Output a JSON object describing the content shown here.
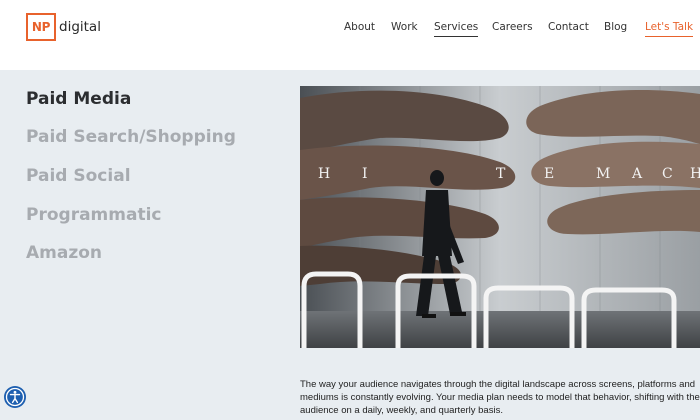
{
  "brand": {
    "logo_mark": "NP",
    "logo_text": "digital",
    "accent": "#e8622c"
  },
  "nav": {
    "items": [
      {
        "label": "About"
      },
      {
        "label": "Work"
      },
      {
        "label": "Services",
        "active": true
      },
      {
        "label": "Careers"
      },
      {
        "label": "Contact"
      },
      {
        "label": "Blog"
      }
    ],
    "cta_label": "Let's Talk"
  },
  "sidebar": {
    "items": [
      {
        "label": "Paid Media",
        "active": true
      },
      {
        "label": "Paid Search/Shopping"
      },
      {
        "label": "Paid Social"
      },
      {
        "label": "Programmatic"
      },
      {
        "label": "Amazon"
      }
    ]
  },
  "hero": {
    "overlay_text": "HI_TEMACH"
  },
  "main": {
    "description": "The way your audience navigates through the digital landscape across screens, platforms and mediums is constantly evolving. Your media plan needs to model that behavior, shifting with the audience on a daily, weekly, and quarterly basis."
  },
  "accessibility": {
    "icon": "accessibility-icon",
    "color": "#1d5fb0"
  }
}
